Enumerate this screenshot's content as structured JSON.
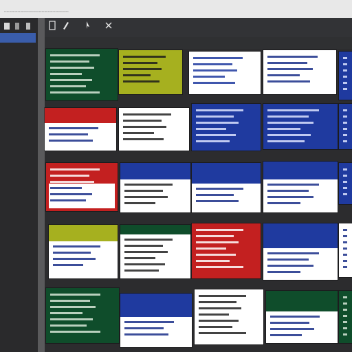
{
  "window": {
    "title": "",
    "title_marks": "┄┄┄┄┄┄┄┄┄┄┄┄┄┄┄┄┄┄┄┄┄┄┄┄"
  },
  "sidebar": {
    "items": [
      "",
      "",
      "",
      "",
      "",
      "",
      "",
      "",
      ""
    ],
    "footer": ""
  },
  "toolbar": {
    "buttons": [
      {
        "icon": "new-doc-icon",
        "label": ""
      },
      {
        "icon": "pen-icon",
        "label": ""
      },
      {
        "icon": "cursor-icon",
        "label": ""
      },
      {
        "icon": "close-icon",
        "label": ""
      }
    ]
  },
  "colors": {
    "green": "#0f4d2b",
    "olive": "#a6b01f",
    "white": "#ffffff",
    "navy": "#1f3a9f",
    "red": "#c32020",
    "sidebar_sel": "#3a5dab"
  },
  "thumbnails": [
    {
      "name": "thumb-green-1",
      "title": "",
      "lines": [
        "",
        "",
        "",
        ""
      ]
    },
    {
      "name": "thumb-olive-1",
      "title": "",
      "lines": [
        "",
        "",
        ""
      ]
    },
    {
      "name": "thumb-white-1",
      "title": "",
      "lines": [
        "",
        "",
        "",
        ""
      ]
    },
    {
      "name": "thumb-white-2",
      "title": "",
      "lines": [
        "",
        "",
        "",
        ""
      ]
    },
    {
      "name": "thumb-navy-1",
      "title": "",
      "lines": [
        "",
        "",
        ""
      ]
    },
    {
      "name": "thumb-red-white-1",
      "title": "",
      "lines": [
        "",
        "",
        ""
      ]
    },
    {
      "name": "thumb-white-3",
      "title": "",
      "lines": [
        "",
        "",
        "",
        ""
      ]
    },
    {
      "name": "thumb-navy-2",
      "title": "",
      "lines": [
        "",
        "",
        ""
      ]
    },
    {
      "name": "thumb-navy-3",
      "title": "",
      "lines": [
        "",
        "",
        "",
        ""
      ]
    },
    {
      "name": "thumb-navy-4",
      "title": "",
      "lines": [
        "",
        ""
      ]
    },
    {
      "name": "thumb-red-1",
      "title": "",
      "lines": [
        "",
        "",
        ""
      ]
    },
    {
      "name": "thumb-navy-white-1",
      "title": "",
      "lines": [
        "",
        "",
        ""
      ]
    },
    {
      "name": "thumb-navy-white-2",
      "title": "",
      "lines": [
        "",
        "",
        ""
      ]
    },
    {
      "name": "thumb-navy-white-3",
      "title": "",
      "lines": [
        "",
        "",
        ""
      ]
    },
    {
      "name": "thumb-navy-5",
      "title": "",
      "lines": [
        ""
      ]
    },
    {
      "name": "thumb-olive-2",
      "title": "",
      "lines": [
        "",
        "",
        "",
        ""
      ]
    },
    {
      "name": "thumb-white-4",
      "title": "",
      "lines": [
        "",
        "",
        "",
        ""
      ]
    },
    {
      "name": "thumb-red-2",
      "title": "",
      "lines": [
        "",
        "",
        ""
      ]
    },
    {
      "name": "thumb-navy-white-4",
      "title": "",
      "lines": [
        "",
        "",
        "",
        ""
      ]
    },
    {
      "name": "thumb-white-5",
      "title": "",
      "lines": [
        "",
        ""
      ]
    },
    {
      "name": "thumb-green-2",
      "title": "",
      "lines": [
        "",
        "",
        "",
        ""
      ]
    },
    {
      "name": "thumb-navy-white-5",
      "title": "",
      "lines": [
        "",
        ""
      ]
    },
    {
      "name": "thumb-white-6",
      "title": "",
      "lines": [
        "",
        "",
        "",
        ""
      ]
    },
    {
      "name": "thumb-green-white-1",
      "title": "",
      "lines": [
        "",
        "",
        ""
      ]
    },
    {
      "name": "thumb-green-3",
      "title": "",
      "lines": [
        "",
        ""
      ]
    }
  ]
}
